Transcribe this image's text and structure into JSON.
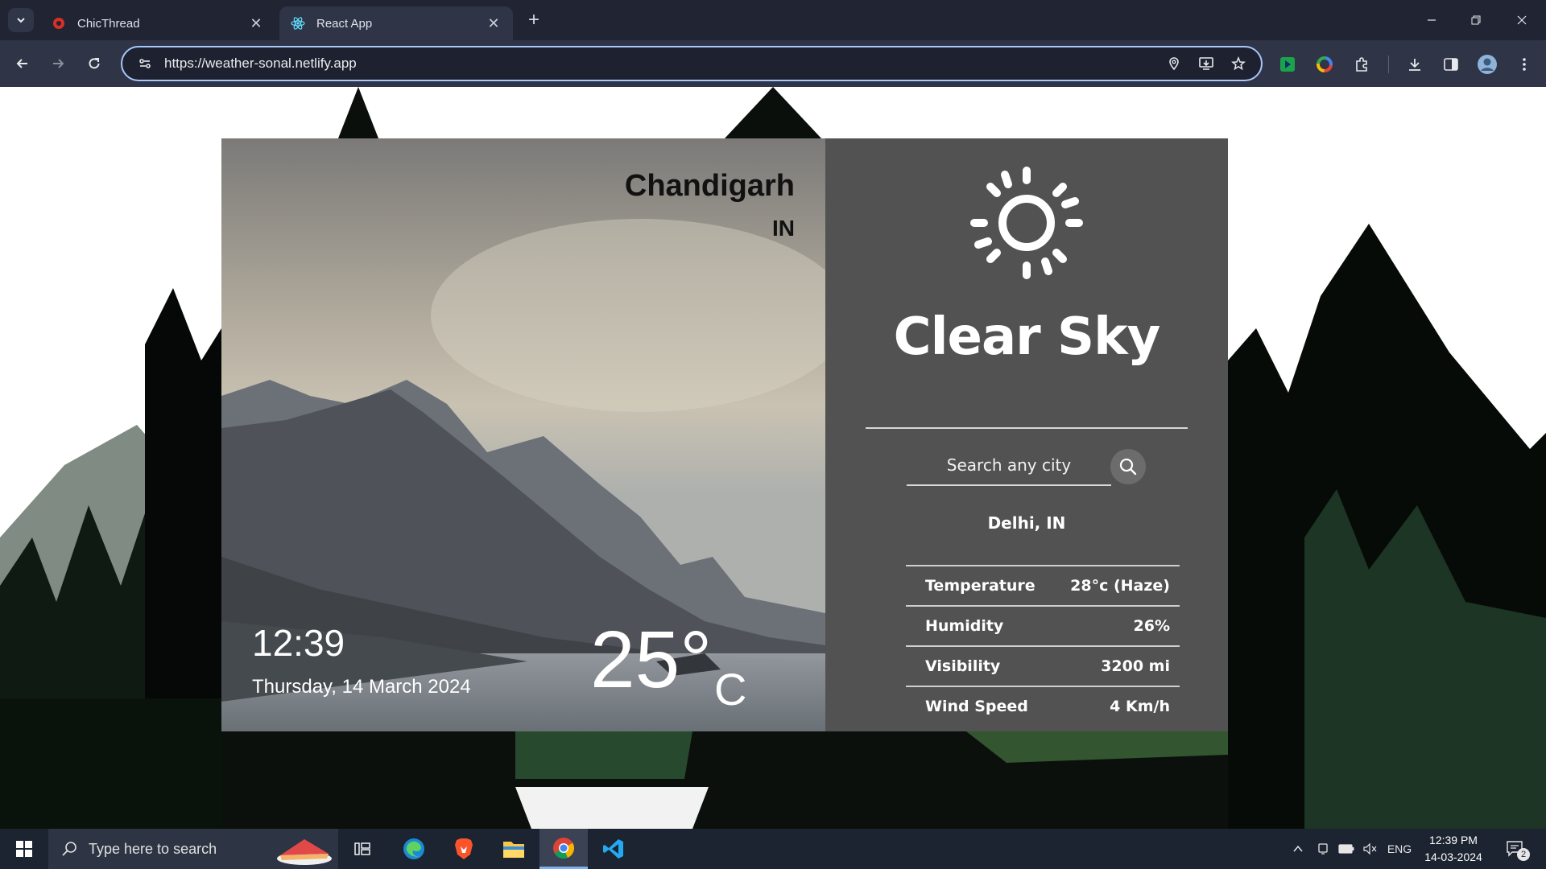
{
  "browser": {
    "tabs": [
      {
        "title": "ChicThread",
        "active": false,
        "favicon": "chicthread-logo-icon"
      },
      {
        "title": "React App",
        "active": true,
        "favicon": "react-logo-icon"
      }
    ],
    "url": "https://weather-sonal.netlify.app"
  },
  "weather": {
    "city": "Chandigarh",
    "country": "IN",
    "time": "12:39",
    "date": "Thursday, 14 March 2024",
    "temperature": "25°",
    "temperature_unit": "C",
    "condition_icon": "sun-icon",
    "condition": "Clear Sky",
    "search": {
      "placeholder": "Search any city"
    },
    "searched_location": "Delhi, IN",
    "stats": [
      {
        "label": "Temperature",
        "value": "28°c (Haze)"
      },
      {
        "label": "Humidity",
        "value": "26%"
      },
      {
        "label": "Visibility",
        "value": "3200 mi"
      },
      {
        "label": "Wind Speed",
        "value": "4 Km/h"
      }
    ]
  },
  "taskbar": {
    "search_placeholder": "Type here to search",
    "language": "ENG",
    "time": "12:39 PM",
    "date": "14-03-2024",
    "notification_count": "2"
  },
  "colors": {
    "accent_focus": "#a8c7fa",
    "card_dark": "#1a1a1a",
    "taskbar": "#1c2331"
  }
}
